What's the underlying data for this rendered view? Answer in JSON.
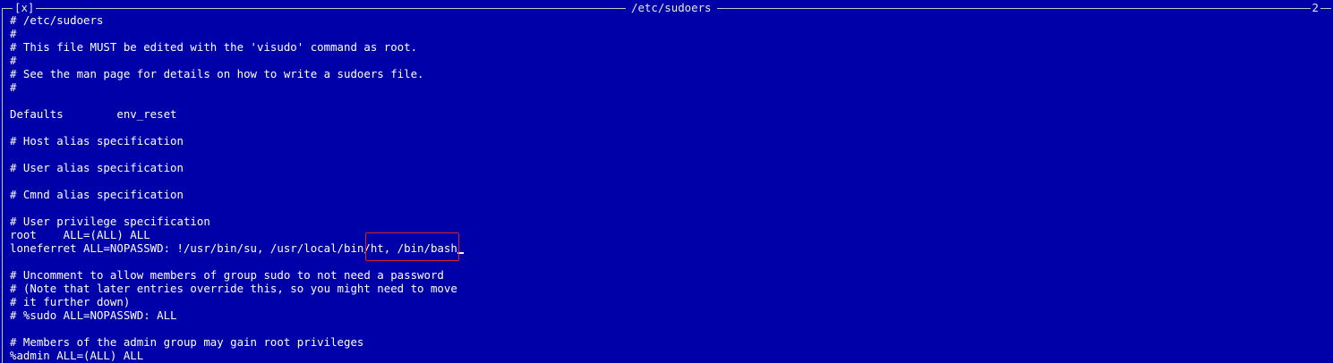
{
  "titlebar": {
    "close_label": "[x]",
    "title": "/etc/sudoers",
    "window_number": "2"
  },
  "lines": [
    "# /etc/sudoers",
    "#",
    "# This file MUST be edited with the 'visudo' command as root.",
    "#",
    "# See the man page for details on how to write a sudoers file.",
    "#",
    "",
    "Defaults        env_reset",
    "",
    "# Host alias specification",
    "",
    "# User alias specification",
    "",
    "# Cmnd alias specification",
    "",
    "# User privilege specification",
    "root    ALL=(ALL) ALL",
    "loneferret ALL=NOPASSWD: !/usr/bin/su, /usr/local/bin/ht, /bin/bash",
    "",
    "# Uncomment to allow members of group sudo to not need a password",
    "# (Note that later entries override this, so you might need to move",
    "# it further down)",
    "# %sudo ALL=NOPASSWD: ALL",
    "",
    "# Members of the admin group may gain root privileges",
    "%admin ALL=(ALL) ALL"
  ],
  "colors": {
    "background": "#0000a8",
    "text": "#ffffff",
    "border": "#c8c8c8",
    "highlight": "#e02020"
  }
}
